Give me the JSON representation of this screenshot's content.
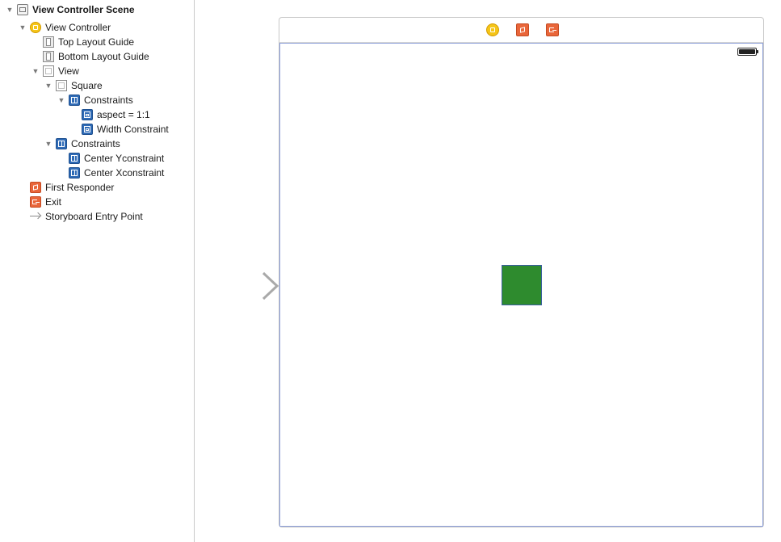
{
  "outline": {
    "scene": {
      "label": "View Controller Scene",
      "disclosure": "▼",
      "icon": "scene-icon"
    },
    "view_controller": {
      "label": "View Controller",
      "disclosure": "▼",
      "icon": "view-controller-icon"
    },
    "top_layout_guide": {
      "label": "Top Layout Guide",
      "icon": "layout-guide-icon"
    },
    "bottom_layout_guide": {
      "label": "Bottom Layout Guide",
      "icon": "layout-guide-icon"
    },
    "view": {
      "label": "View",
      "disclosure": "▼",
      "icon": "view-icon"
    },
    "square": {
      "label": "Square",
      "disclosure": "▼",
      "icon": "view-icon"
    },
    "square_constraints": {
      "label": "Constraints",
      "disclosure": "▼",
      "icon": "constraints-icon"
    },
    "aspect_constraint": {
      "label": "aspect = 1:1",
      "icon": "constraint-icon"
    },
    "width_constraint": {
      "label": "Width Constraint",
      "icon": "constraint-icon"
    },
    "view_constraints": {
      "label": "Constraints",
      "disclosure": "▼",
      "icon": "constraints-icon"
    },
    "center_y_constraint": {
      "label": "Center Yconstraint",
      "icon": "constraint-icon"
    },
    "center_x_constraint": {
      "label": "Center Xconstraint",
      "icon": "constraint-icon"
    },
    "first_responder": {
      "label": "First Responder",
      "icon": "first-responder-icon"
    },
    "exit": {
      "label": "Exit",
      "icon": "exit-icon"
    },
    "storyboard_entry_point": {
      "label": "Storyboard Entry Point",
      "icon": "entry-point-icon"
    }
  },
  "canvas": {
    "dock_icons": [
      "view-controller-icon",
      "first-responder-icon",
      "exit-icon"
    ],
    "status_bar": {
      "battery_icon": "battery-icon",
      "battery_level": 1.0
    },
    "square": {
      "color": "#2e8b2e",
      "border_color": "#3a5fa0"
    },
    "view_border_color": "#8ea0da",
    "entry_arrow_color": "#a9a9a9"
  },
  "colors": {
    "constraint_blue": "#2f6bb6",
    "vc_yellow": "#f5c518",
    "responder_orange": "#e9663a"
  }
}
